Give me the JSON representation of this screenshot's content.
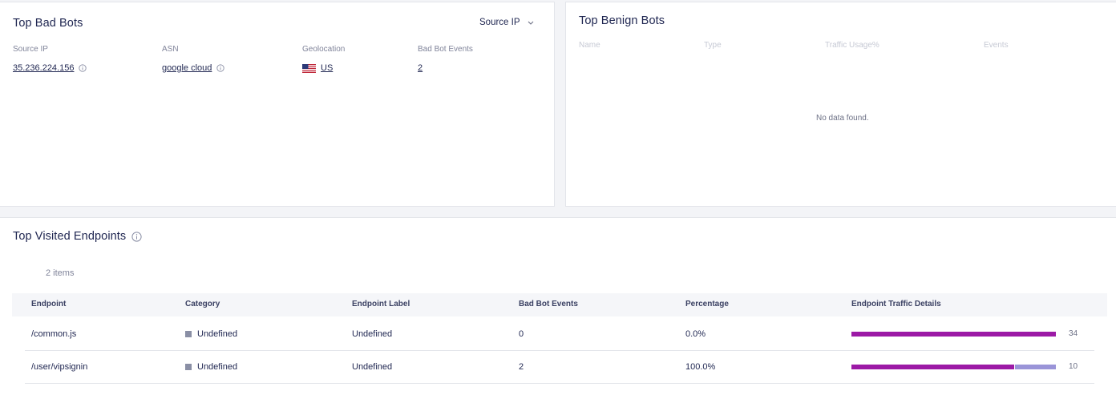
{
  "bad_bots": {
    "title": "Top Bad Bots",
    "dropdown_label": "Source IP",
    "columns": [
      "Source IP",
      "ASN",
      "Geolocation",
      "Bad Bot Events"
    ],
    "rows": [
      {
        "source_ip": "35.236.224.156",
        "asn": "google cloud",
        "geolocation": "US",
        "events": "2"
      }
    ]
  },
  "benign_bots": {
    "title": "Top Benign Bots",
    "columns": [
      "Name",
      "Type",
      "Traffic Usage%",
      "Events"
    ],
    "empty_text": "No data found."
  },
  "endpoints": {
    "title": "Top Visited Endpoints",
    "items_count": "2 items",
    "columns": [
      "Endpoint",
      "Category",
      "Endpoint Label",
      "Bad Bot Events",
      "Percentage",
      "Endpoint Traffic Details"
    ],
    "rows": [
      {
        "endpoint": "/common.js",
        "category": "Undefined",
        "label": "Undefined",
        "events": "0",
        "percentage": "0.0%",
        "traffic_total": "34",
        "traffic_segments": [
          1.0,
          0.0
        ]
      },
      {
        "endpoint": "/user/vipsignin",
        "category": "Undefined",
        "label": "Undefined",
        "events": "2",
        "percentage": "100.0%",
        "traffic_total": "10",
        "traffic_segments": [
          0.8,
          0.2
        ]
      }
    ]
  },
  "colors": {
    "bar_primary": "#9c1aa6",
    "bar_secondary": "#9a94d8",
    "category_square": "#8a8fa5"
  }
}
